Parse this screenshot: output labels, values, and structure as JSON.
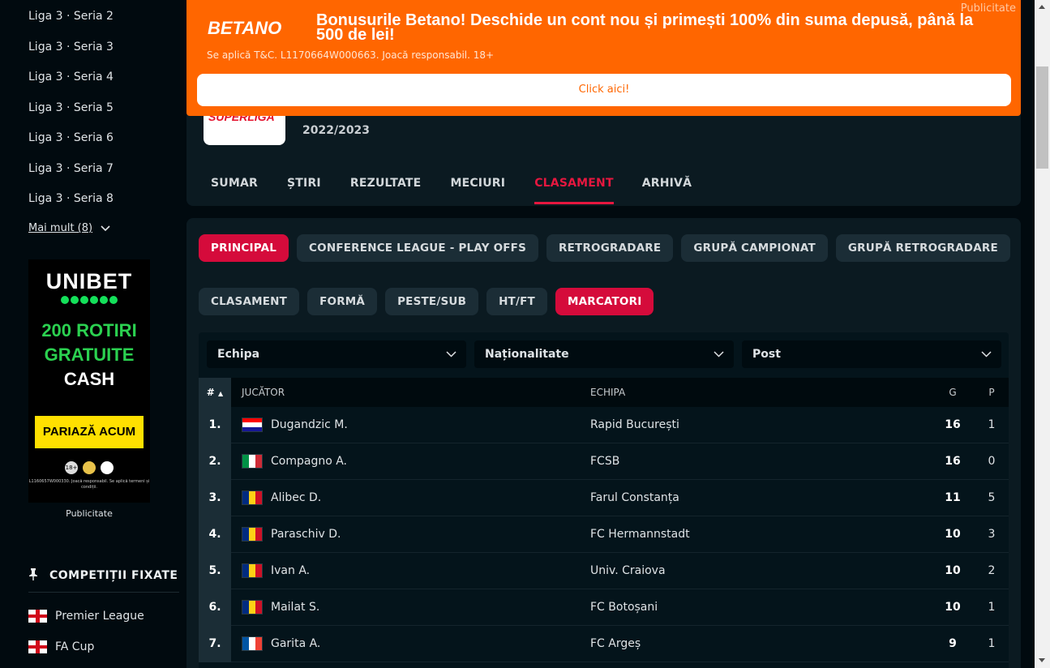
{
  "sidebar": {
    "leagues": [
      "Liga 3 · Seria 2",
      "Liga 3 · Seria 3",
      "Liga 3 · Seria 4",
      "Liga 3 · Seria 5",
      "Liga 3 · Seria 6",
      "Liga 3 · Seria 7",
      "Liga 3 · Seria 8"
    ],
    "more": "Mai mult (8)",
    "ad": {
      "brand": "UNIBET",
      "offer_line1": "200 ROTIRI",
      "offer_line2": "GRATUITE",
      "offer_line3": "CASH",
      "cta": "PARIAZĂ ACUM",
      "badge": "18+",
      "fine_print": "L1160657W000330. Joacă responsabil. Se aplică termeni și condiții.",
      "label": "Publicitate"
    },
    "pinned_title": "COMPETIȚII FIXATE",
    "pinned": [
      "Premier League",
      "FA Cup"
    ]
  },
  "banner": {
    "logo": "BETANO",
    "headline": "Bonusurile Betano! Deschide un cont nou și primești 100% din suma depusă, până la 500 de lei!",
    "terms": "Se aplică T&C. L1170664W000663. Joacă responsabil. 18+",
    "cta": "Click aici!",
    "ad_label": "Publicitate"
  },
  "header": {
    "logo_text": "SUPERLIGA",
    "season": "2022/2023",
    "nav": [
      "SUMAR",
      "ȘTIRI",
      "REZULTATE",
      "MECIURI",
      "CLASAMENT",
      "ARHIVĂ"
    ],
    "nav_active": "CLASAMENT"
  },
  "stage_tabs": [
    "PRINCIPAL",
    "CONFERENCE LEAGUE - PLAY OFFS",
    "RETROGRADARE",
    "GRUPĂ CAMPIONAT",
    "GRUPĂ RETROGRADARE"
  ],
  "stage_active": "PRINCIPAL",
  "view_tabs": [
    "CLASAMENT",
    "FORMĂ",
    "PESTE/SUB",
    "HT/FT",
    "MARCATORI"
  ],
  "view_active": "MARCATORI",
  "filters": [
    "Echipa",
    "Naționalitate",
    "Post"
  ],
  "table": {
    "headers": {
      "rank": "#",
      "sort": "▲",
      "player": "JUCĂTOR",
      "team": "ECHIPA",
      "goals": "G",
      "assists": "P"
    },
    "rows": [
      {
        "rank": "1.",
        "player": "Dugandzic M.",
        "flag": "croatia",
        "team": "Rapid București",
        "goals": "16",
        "assists": "1"
      },
      {
        "rank": "2.",
        "player": "Compagno A.",
        "flag": "italy",
        "team": "FCSB",
        "goals": "16",
        "assists": "0"
      },
      {
        "rank": "3.",
        "player": "Alibec D.",
        "flag": "romania",
        "team": "Farul Constanța",
        "goals": "11",
        "assists": "5"
      },
      {
        "rank": "4.",
        "player": "Paraschiv D.",
        "flag": "romania",
        "team": "FC Hermannstadt",
        "goals": "10",
        "assists": "3"
      },
      {
        "rank": "5.",
        "player": "Ivan A.",
        "flag": "romania",
        "team": "Univ. Craiova",
        "goals": "10",
        "assists": "2"
      },
      {
        "rank": "6.",
        "player": "Mailat S.",
        "flag": "romania",
        "team": "FC Botoșani",
        "goals": "10",
        "assists": "1"
      },
      {
        "rank": "7.",
        "player": "Garita A.",
        "flag": "france",
        "team": "FC Argeș",
        "goals": "9",
        "assists": "1"
      }
    ]
  },
  "colors": {
    "accent": "#d50b3b",
    "betano_orange": "#ff6600",
    "unibet_green": "#14e05a",
    "background": "#010a0f",
    "card": "#0b1a21"
  }
}
